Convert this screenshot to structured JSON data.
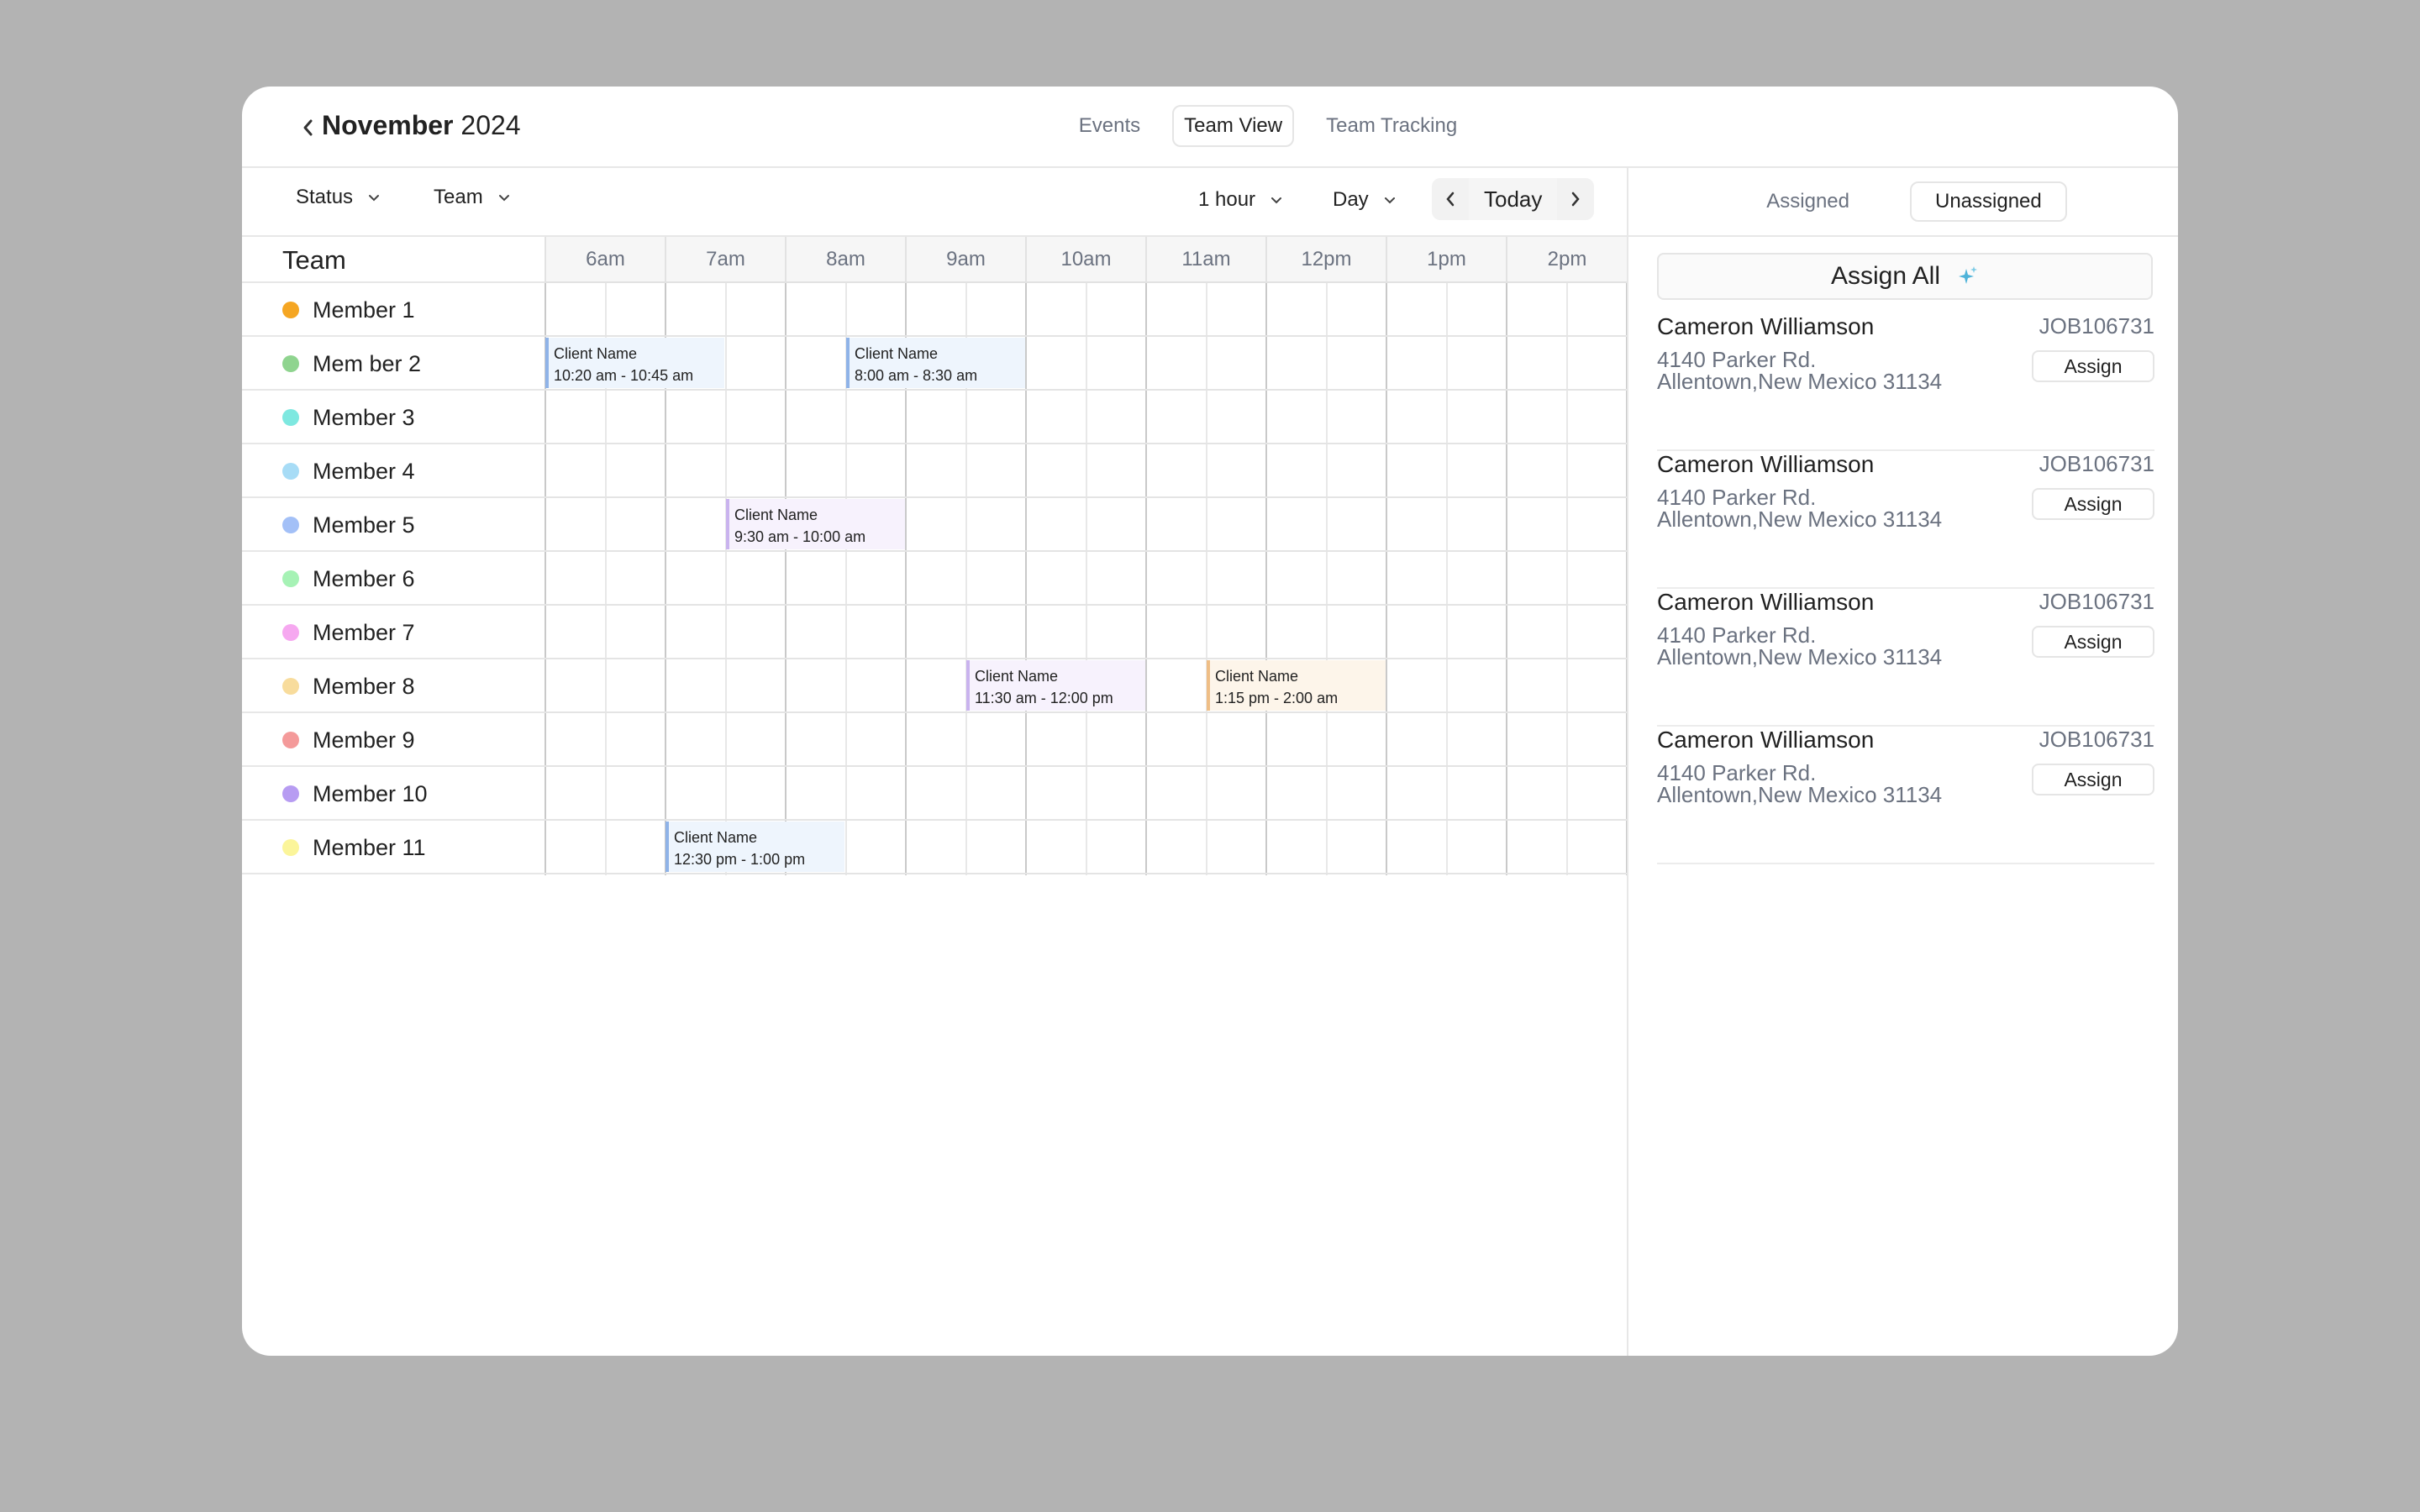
{
  "header": {
    "month": "November",
    "year": "2024",
    "tabs": [
      {
        "label": "Events",
        "active": false
      },
      {
        "label": "Team View",
        "active": true
      },
      {
        "label": "Team Tracking",
        "active": false
      }
    ]
  },
  "toolbar": {
    "status_label": "Status",
    "team_label": "Team",
    "interval_label": "1 hour",
    "range_label": "Day",
    "today_label": "Today"
  },
  "grid": {
    "team_heading": "Team",
    "hours": [
      "6am",
      "7am",
      "8am",
      "9am",
      "10am",
      "11am",
      "12pm",
      "1pm",
      "2pm"
    ],
    "members": [
      {
        "name": "Member 1",
        "color": "#f5a623"
      },
      {
        "name": "Mem ber 2",
        "color": "#8fd48f"
      },
      {
        "name": "Member 3",
        "color": "#7ee8e0"
      },
      {
        "name": "Member 4",
        "color": "#a7dcf6"
      },
      {
        "name": "Member 5",
        "color": "#a3c0f7"
      },
      {
        "name": "Member 6",
        "color": "#a6f2b5"
      },
      {
        "name": "Member 7",
        "color": "#f6a8f0"
      },
      {
        "name": "Member 8",
        "color": "#f8dc9c"
      },
      {
        "name": "Member 9",
        "color": "#f49a9a"
      },
      {
        "name": "Member 10",
        "color": "#b79cf2"
      },
      {
        "name": "Member 11",
        "color": "#fbf59a"
      }
    ],
    "events": [
      {
        "member": 1,
        "title": "Client Name",
        "time": "10:20 am - 10:45 am",
        "bg": "#eef5fd",
        "accent": "#8fb3e8"
      },
      {
        "member": 1,
        "title": "Client Name",
        "time": "8:00 am - 8:30 am",
        "bg": "#eef5fd",
        "accent": "#8fb3e8"
      },
      {
        "member": 4,
        "title": "Client Name",
        "time": "9:30 am - 10:00 am",
        "bg": "#f7f2fd",
        "accent": "#c9b3ee"
      },
      {
        "member": 7,
        "title": "Client Name",
        "time": "11:30 am - 12:00 pm",
        "bg": "#f7f2fd",
        "accent": "#c9b3ee"
      },
      {
        "member": 7,
        "title": "Client Name",
        "time": "1:15 pm - 2:00 am",
        "bg": "#fdf5ea",
        "accent": "#efbe86"
      },
      {
        "member": 10,
        "title": "Client Name",
        "time": "12:30 pm - 1:00 pm",
        "bg": "#eef5fd",
        "accent": "#8fb3e8"
      }
    ]
  },
  "panel": {
    "tabs": [
      {
        "label": "Assigned",
        "active": false
      },
      {
        "label": "Unassigned",
        "active": true
      }
    ],
    "assign_all_label": "Assign All",
    "assign_all_icon": "sparkle-icon",
    "jobs": [
      {
        "name": "Cameron Williamson",
        "id": "JOB106731",
        "address_line1": "4140 Parker Rd.",
        "address_line2": "Allentown,New Mexico 31134",
        "button": "Assign"
      },
      {
        "name": "Cameron Williamson",
        "id": "JOB106731",
        "address_line1": "4140 Parker Rd.",
        "address_line2": "Allentown,New Mexico 31134",
        "button": "Assign"
      },
      {
        "name": "Cameron Williamson",
        "id": "JOB106731",
        "address_line1": "4140 Parker Rd.",
        "address_line2": "Allentown,New Mexico 31134",
        "button": "Assign"
      },
      {
        "name": "Cameron Williamson",
        "id": "JOB106731",
        "address_line1": "4140 Parker Rd.",
        "address_line2": "Allentown,New Mexico 31134",
        "button": "Assign"
      }
    ]
  }
}
